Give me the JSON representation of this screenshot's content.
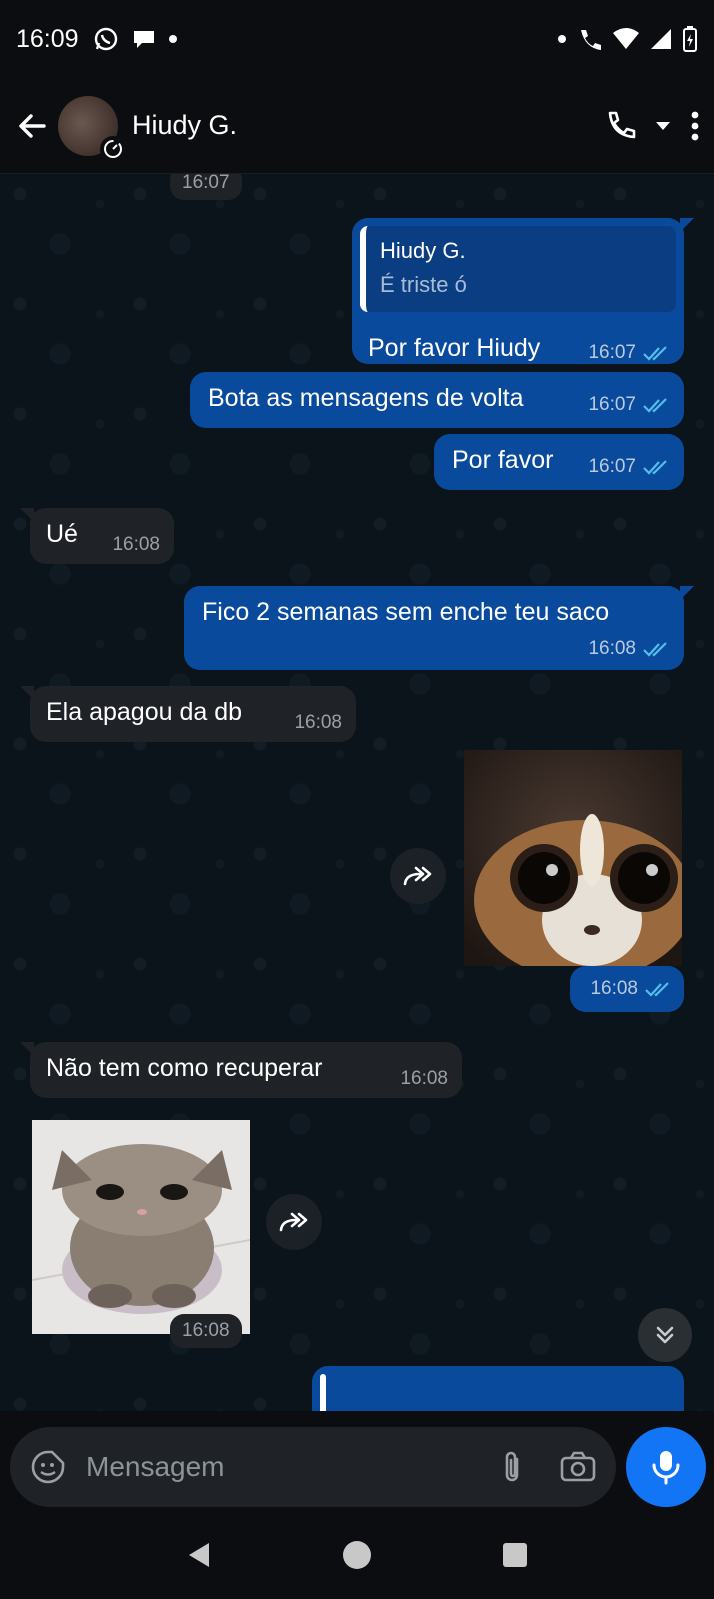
{
  "status_bar": {
    "time": "16:09"
  },
  "header": {
    "contact_name": "Hiudy G."
  },
  "messages": [
    {
      "type": "time_chip",
      "time": "16:07"
    },
    {
      "type": "out",
      "quote_name": "Hiudy G.",
      "quote_text": "É triste ó",
      "text": "Por favor Hiudy",
      "time": "16:07",
      "read": true
    },
    {
      "type": "out",
      "text": "Bota as mensagens de volta",
      "time": "16:07",
      "read": true
    },
    {
      "type": "out",
      "text": "Por favor",
      "time": "16:07",
      "read": true
    },
    {
      "type": "in",
      "text": "Ué",
      "time": "16:08"
    },
    {
      "type": "out",
      "text": "Fico 2 semanas sem enche teu saco",
      "time": "16:08",
      "read": true
    },
    {
      "type": "in",
      "text": "Ela apagou da db",
      "time": "16:08"
    },
    {
      "type": "out_sticker",
      "time": "16:08",
      "read": true
    },
    {
      "type": "in",
      "text": "Não tem como recuperar",
      "time": "16:08"
    },
    {
      "type": "in_sticker",
      "time": "16:08"
    }
  ],
  "composer": {
    "placeholder": "Mensagem"
  },
  "colors": {
    "outgoing": "#0a4a9c",
    "incoming": "#1f2327",
    "accent": "#1275f5",
    "read_ticks": "#53bdeb"
  },
  "icons": [
    "whatsapp-icon",
    "message-icon",
    "wifi-call-icon",
    "wifi-icon",
    "signal-icon",
    "battery-icon",
    "back-arrow-icon",
    "timer-icon",
    "phone-icon",
    "dropdown-icon",
    "more-vert-icon",
    "forward-icon",
    "double-chevron-down-icon",
    "sticker-icon",
    "attach-icon",
    "camera-icon",
    "mic-icon",
    "nav-back-icon",
    "nav-home-icon",
    "nav-recents-icon"
  ]
}
